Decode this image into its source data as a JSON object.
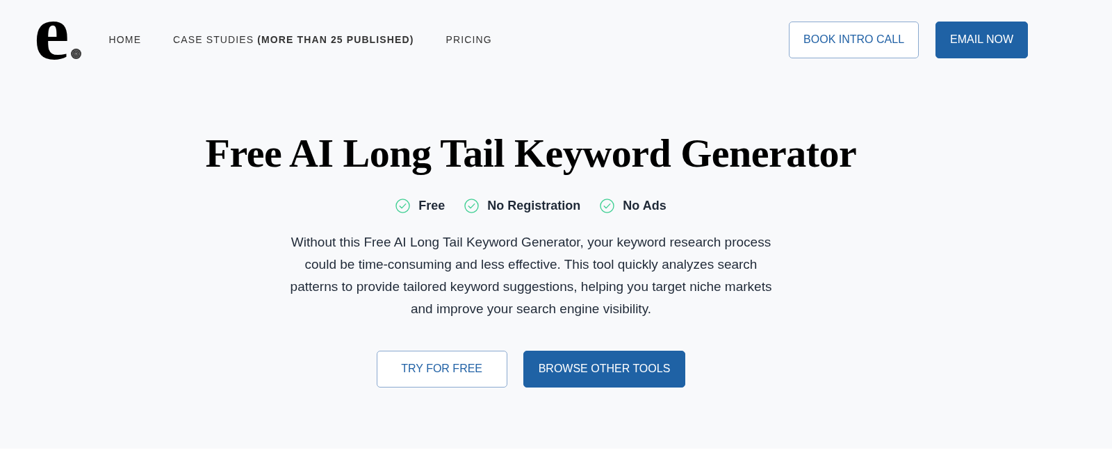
{
  "header": {
    "logo": "e",
    "nav": [
      {
        "label": "HOME"
      },
      {
        "label": "CASE STUDIES **(MORE THAN 25 PUBLISHED)**"
      },
      {
        "label": "PRICING"
      }
    ],
    "buttons": [
      {
        "label": "BOOK INTRO CALL",
        "kind": "outline"
      },
      {
        "label": "EMAIL NOW",
        "kind": "solid"
      }
    ]
  },
  "hero": {
    "title": "Free AI Long Tail Keyword Generator",
    "features": [
      "Free",
      "No Registration",
      "No Ads"
    ],
    "description": "Without this Free AI Long Tail Keyword Generator, your keyword research process could be time-consuming and less effective. This tool quickly analyzes search patterns to provide tailored keyword suggestions, helping you target niche markets and improve your search engine visibility.",
    "buttons": [
      {
        "label": "TRY FOR FREE",
        "kind": "outline"
      },
      {
        "label": "BROWSE OTHER TOOLS",
        "kind": "solid"
      }
    ]
  }
}
